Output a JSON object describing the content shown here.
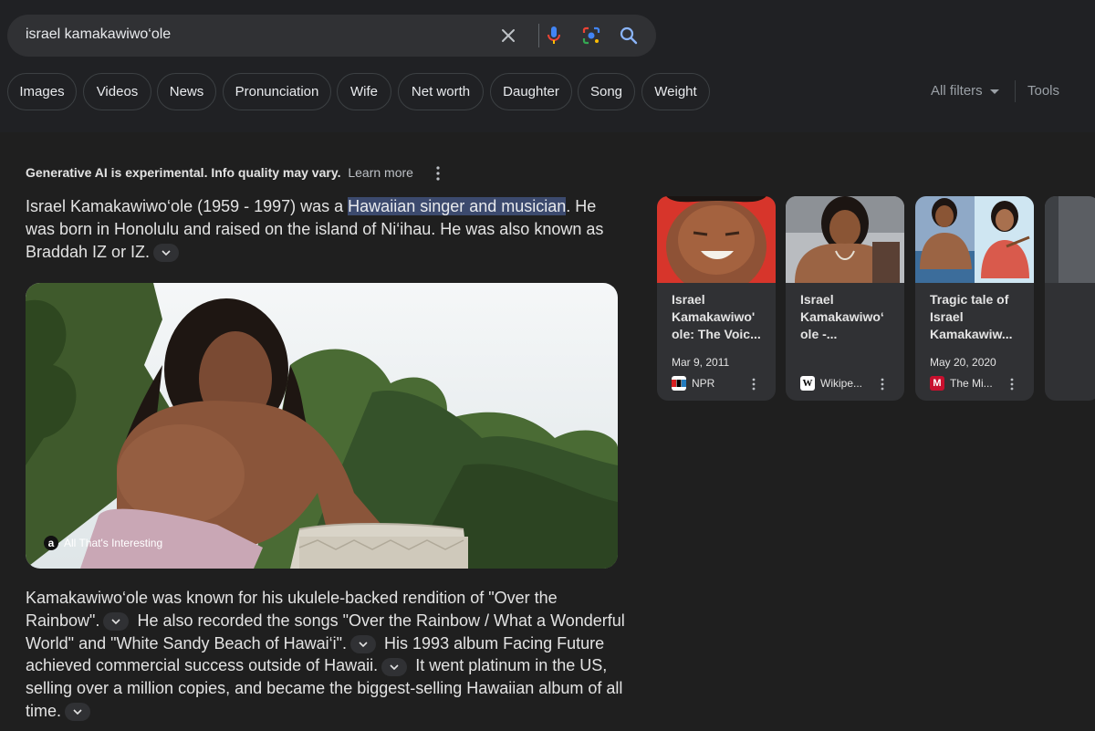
{
  "search": {
    "query": "israel kamakawiwo‘ole",
    "icons": [
      "clear-icon",
      "mic-icon",
      "lens-icon",
      "search-icon"
    ]
  },
  "chips": [
    "Images",
    "Videos",
    "News",
    "Pronunciation",
    "Wife",
    "Net worth",
    "Daughter",
    "Song",
    "Weight"
  ],
  "filters": {
    "all_filters": "All filters",
    "tools": "Tools"
  },
  "ai": {
    "notice": "Generative AI is experimental. Info quality may vary.",
    "learn_more": "Learn more",
    "para1_before": "Israel Kamakawiwo‘ole (1959 - 1997) was a ",
    "para1_highlight": "Hawaiian singer and musician",
    "para1_after": ". He was born in Honolulu and raised on the island of Ni‘ihau. He was also known as Braddah IZ or IZ.",
    "image_source": "All That's Interesting",
    "image_source_logo": "a",
    "para2_s1": "Kamakawiwo‘ole was known for his ukulele-backed rendition of \"Over the Rainbow\".",
    "para2_s2": "He also recorded the songs \"Over the Rainbow / What a Wonderful World\" and \"White Sandy Beach of Hawai‘i\".",
    "para2_s3": "His 1993 album Facing Future achieved commercial success outside of Hawaii.",
    "para2_s4": "It went platinum in the US, selling over a million copies, and became the biggest-selling Hawaiian album of all time."
  },
  "cards": [
    {
      "title": "Israel Kamakawiwo' ole: The Voic...",
      "date": "Mar 9, 2011",
      "source": "NPR",
      "favicon": "npr",
      "favicon_color": "#ffffff"
    },
    {
      "title": "Israel Kamakawiwoʻ ole -...",
      "date": "",
      "source": "Wikipe...",
      "favicon": "W",
      "favicon_color": "#ffffff"
    },
    {
      "title": "Tragic tale of Israel Kamakawiw...",
      "date": "May 20, 2020",
      "source": "The Mi...",
      "favicon": "M",
      "favicon_color": "#c8102e"
    }
  ],
  "colors": {
    "background": "#1f1f1f",
    "header": "#202124",
    "highlight": "#3c4a6e",
    "card": "#303134"
  }
}
